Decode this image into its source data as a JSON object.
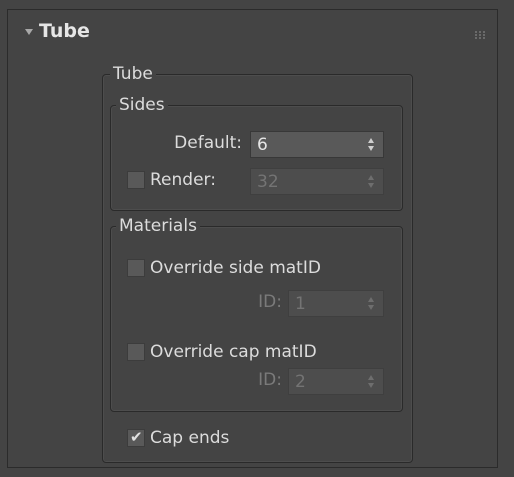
{
  "rollout": {
    "title": "Tube",
    "expanded": true
  },
  "group_tube": {
    "label": "Tube"
  },
  "sides": {
    "label": "Sides",
    "default_label": "Default:",
    "default_value": "6",
    "render_label": "Render:",
    "render_value": "32",
    "render_checked": false
  },
  "materials": {
    "label": "Materials",
    "override_side_label": "Override side matID",
    "override_side_checked": false,
    "side_id_label": "ID:",
    "side_id_value": "1",
    "override_cap_label": "Override cap matID",
    "override_cap_checked": false,
    "cap_id_label": "ID:",
    "cap_id_value": "2"
  },
  "cap_ends": {
    "label": "Cap ends",
    "checked": true
  },
  "icons": {
    "collapse": "triangle-down-icon",
    "grip": "drag-grip-icon",
    "check": "checkmark-icon"
  }
}
